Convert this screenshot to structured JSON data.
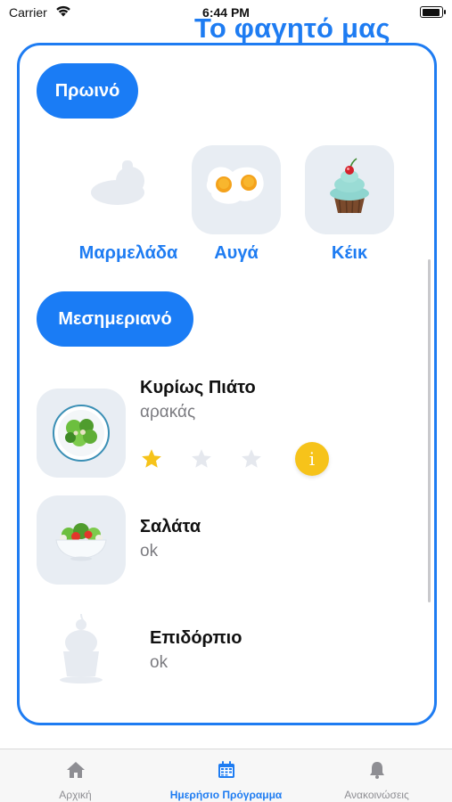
{
  "status_bar": {
    "carrier": "Carrier",
    "time": "6:44 PM"
  },
  "page": {
    "title": "Το φαγητό μας"
  },
  "breakfast": {
    "section_label": "Πρωινό",
    "items": [
      {
        "label": "Μαρμελάδα",
        "icon": "jam-plate-placeholder-icon"
      },
      {
        "label": "Αυγά",
        "icon": "fried-eggs-icon"
      },
      {
        "label": "Κέικ",
        "icon": "cupcake-icon"
      }
    ]
  },
  "lunch": {
    "section_label": "Μεσημεριανό",
    "meals": [
      {
        "title": "Κυρίως Πιάτο",
        "subtitle": "αρακάς",
        "icon": "salad-plate-icon",
        "rating": 1,
        "rating_max": 3,
        "info": "i"
      },
      {
        "title": "Σαλάτα",
        "subtitle": "ok",
        "icon": "salad-bowl-icon"
      },
      {
        "title": "Επιδόρπιο",
        "subtitle": "ok",
        "icon": "dessert-placeholder-icon"
      }
    ]
  },
  "tabbar": {
    "tabs": [
      {
        "label": "Αρχική",
        "icon": "home-icon",
        "active": false
      },
      {
        "label": "Ημερήσιο Πρόγραμμα",
        "icon": "calendar-icon",
        "active": true
      },
      {
        "label": "Ανακοινώσεις",
        "icon": "bell-icon",
        "active": false
      }
    ]
  },
  "colors": {
    "accent": "#1e7cf2",
    "tile": "#e8edf3",
    "star_active": "#f6c31a",
    "star_inactive": "#e5e8ee"
  }
}
